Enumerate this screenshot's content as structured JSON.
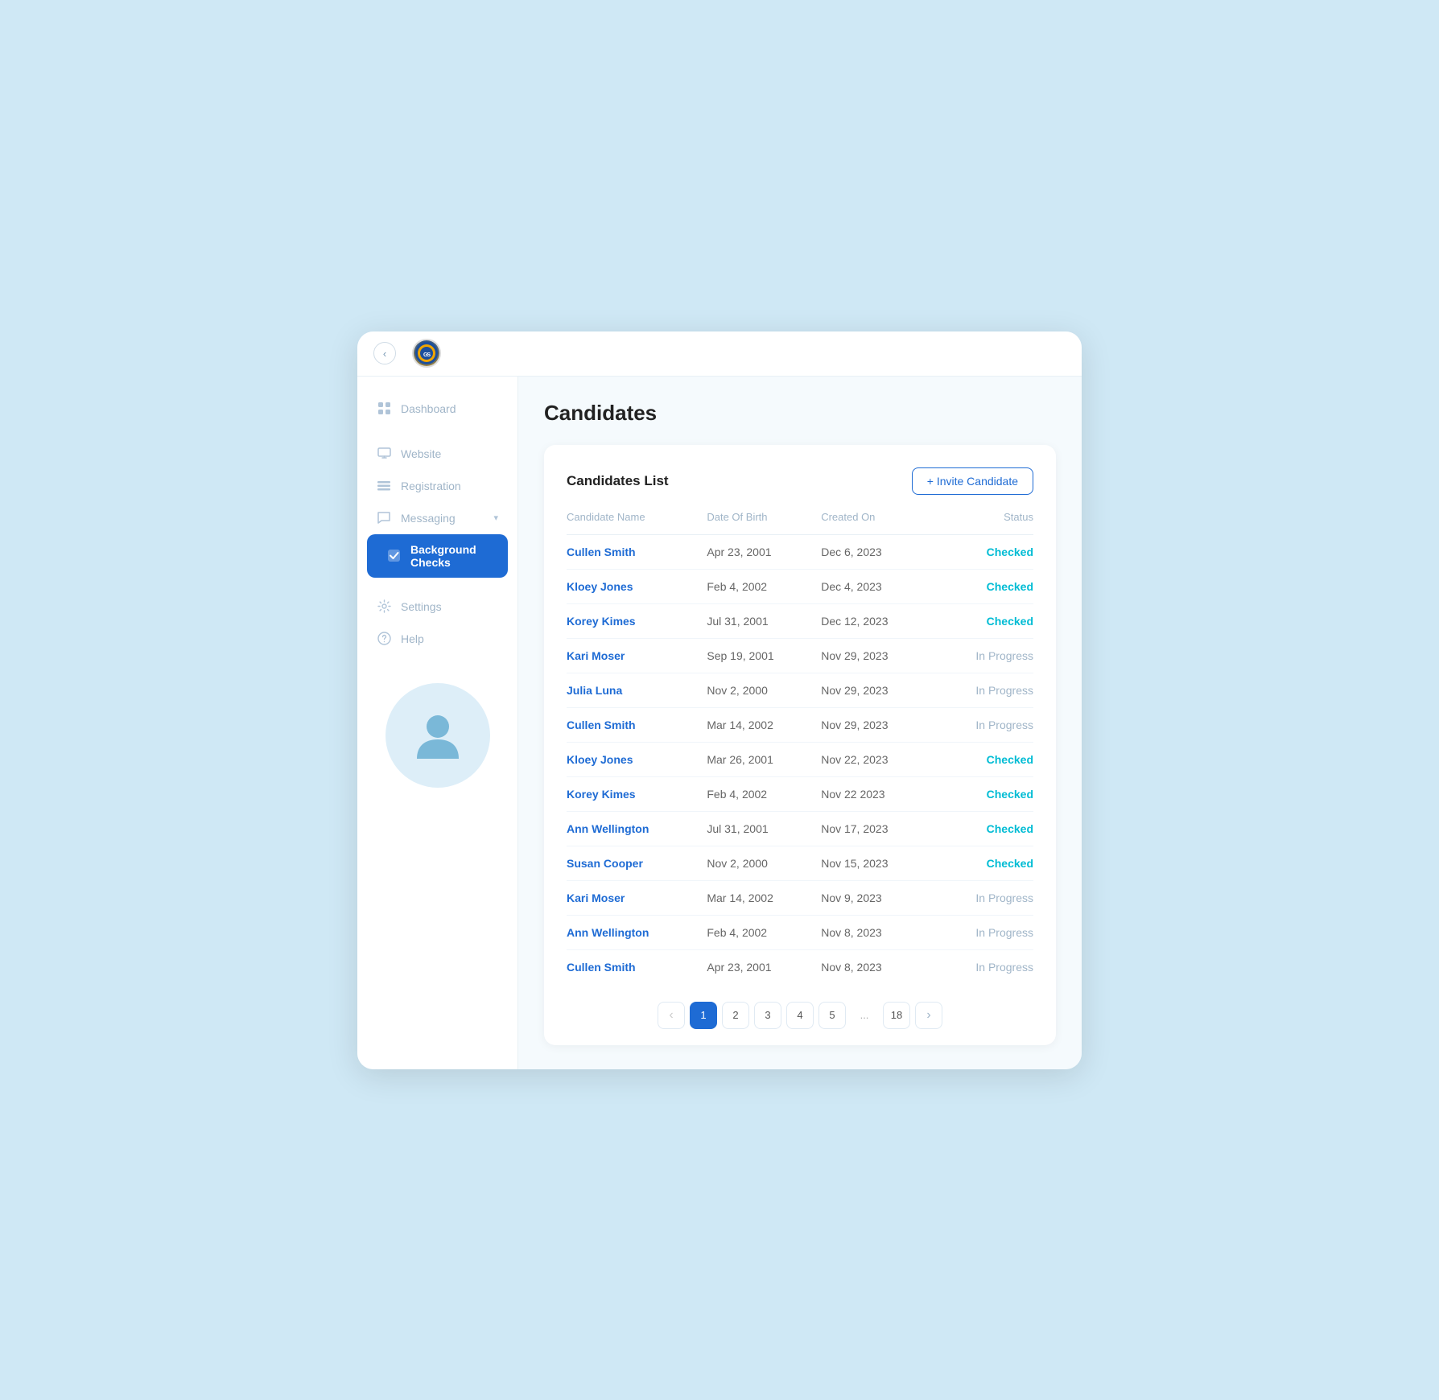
{
  "topbar": {
    "collapse_label": "‹",
    "logo_text": "GS"
  },
  "sidebar": {
    "items": [
      {
        "id": "dashboard",
        "label": "Dashboard",
        "icon": "grid"
      },
      {
        "id": "website",
        "label": "Website",
        "icon": "monitor"
      },
      {
        "id": "registration",
        "label": "Registration",
        "icon": "list"
      },
      {
        "id": "messaging",
        "label": "Messaging",
        "icon": "chat",
        "has_arrow": true
      },
      {
        "id": "background-checks",
        "label": "Background Checks",
        "icon": "check-square",
        "active": true
      },
      {
        "id": "settings",
        "label": "Settings",
        "icon": "gear"
      },
      {
        "id": "help",
        "label": "Help",
        "icon": "question"
      }
    ]
  },
  "page": {
    "title": "Candidates"
  },
  "candidates_card": {
    "title": "Candidates List",
    "invite_button": "+ Invite Candidate",
    "columns": [
      "Candidate Name",
      "Date Of Birth",
      "Created On",
      "Status"
    ],
    "rows": [
      {
        "name": "Cullen Smith",
        "dob": "Apr 23, 2001",
        "created": "Dec 6, 2023",
        "status": "Checked",
        "status_type": "checked"
      },
      {
        "name": "Kloey Jones",
        "dob": "Feb 4, 2002",
        "created": "Dec 4, 2023",
        "status": "Checked",
        "status_type": "checked"
      },
      {
        "name": "Korey Kimes",
        "dob": "Jul 31, 2001",
        "created": "Dec 12, 2023",
        "status": "Checked",
        "status_type": "checked"
      },
      {
        "name": "Kari Moser",
        "dob": "Sep 19, 2001",
        "created": "Nov 29, 2023",
        "status": "In Progress",
        "status_type": "inprogress"
      },
      {
        "name": "Julia Luna",
        "dob": "Nov 2, 2000",
        "created": "Nov 29, 2023",
        "status": "In Progress",
        "status_type": "inprogress"
      },
      {
        "name": "Cullen Smith",
        "dob": "Mar 14, 2002",
        "created": "Nov 29, 2023",
        "status": "In Progress",
        "status_type": "inprogress"
      },
      {
        "name": "Kloey Jones",
        "dob": "Mar 26, 2001",
        "created": "Nov 22, 2023",
        "status": "Checked",
        "status_type": "checked"
      },
      {
        "name": "Korey Kimes",
        "dob": "Feb 4, 2002",
        "created": "Nov 22 2023",
        "status": "Checked",
        "status_type": "checked"
      },
      {
        "name": "Ann Wellington",
        "dob": "Jul 31, 2001",
        "created": "Nov 17, 2023",
        "status": "Checked",
        "status_type": "checked"
      },
      {
        "name": "Susan Cooper",
        "dob": "Nov 2, 2000",
        "created": "Nov 15, 2023",
        "status": "Checked",
        "status_type": "checked"
      },
      {
        "name": "Kari Moser",
        "dob": "Mar 14, 2002",
        "created": "Nov 9, 2023",
        "status": "In Progress",
        "status_type": "inprogress"
      },
      {
        "name": "Ann Wellington",
        "dob": "Feb 4, 2002",
        "created": "Nov 8, 2023",
        "status": "In Progress",
        "status_type": "inprogress"
      },
      {
        "name": "Cullen Smith",
        "dob": "Apr 23, 2001",
        "created": "Nov 8, 2023",
        "status": "In Progress",
        "status_type": "inprogress"
      }
    ]
  },
  "pagination": {
    "pages": [
      "1",
      "2",
      "3",
      "4",
      "5",
      "...",
      "18"
    ],
    "current": "1",
    "prev_label": "‹",
    "next_label": "›"
  }
}
